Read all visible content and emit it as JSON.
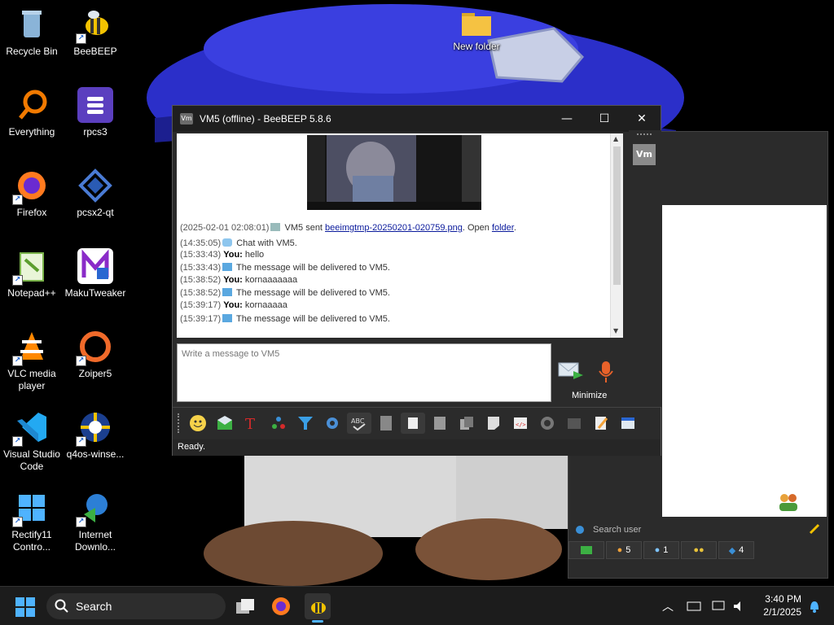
{
  "desktop": {
    "icons": [
      {
        "label": "Recycle Bin"
      },
      {
        "label": "BeeBEEP"
      },
      {
        "label": "Everything"
      },
      {
        "label": "rpcs3"
      },
      {
        "label": "Firefox"
      },
      {
        "label": "pcsx2-qt"
      },
      {
        "label": "Notepad++"
      },
      {
        "label": "MakuTweaker"
      },
      {
        "label": "VLC media player"
      },
      {
        "label": "Zoiper5"
      },
      {
        "label": "Visual Studio Code"
      },
      {
        "label": "q4os-winse..."
      },
      {
        "label": "Rectify11 Contro..."
      },
      {
        "label": "Internet Downlo..."
      },
      {
        "label": "New folder"
      }
    ]
  },
  "chat_window": {
    "title": "VM5 (offline) - BeeBEEP 5.8.6",
    "title_icon_text": "Vm",
    "avatar_text": "Vm",
    "log": [
      {
        "ts": "(2025-02-01 02:08:01)",
        "text": " VM5 sent ",
        "link": "beeimgtmp-20250201-020759.png",
        "after": ". Open ",
        "link2": "folder",
        "tail": "."
      },
      {
        "ts": "(14:35:05)",
        "text": " Chat with VM5."
      },
      {
        "ts": "(15:33:43)",
        "who": "You:",
        "text": " hello"
      },
      {
        "ts": "(15:33:43)",
        "text": " The message will be delivered to VM5."
      },
      {
        "ts": "(15:38:52)",
        "who": "You:",
        "text": " kornaaaaaaa"
      },
      {
        "ts": "(15:38:52)",
        "text": " The message will be delivered to VM5."
      },
      {
        "ts": "(15:39:17)",
        "who": "You:",
        "text": " kornaaaaa"
      },
      {
        "ts": "(15:39:17)",
        "text": " The message will be delivered to VM5."
      }
    ],
    "input_placeholder": "Write a message to VM5",
    "minimize_label": "Minimize",
    "status": "Ready."
  },
  "bg_window": {
    "search_placeholder": "Search user",
    "tabs": [
      {
        "count": ""
      },
      {
        "count": "5"
      },
      {
        "count": "1"
      },
      {
        "count": ""
      },
      {
        "count": "4"
      }
    ]
  },
  "taskbar": {
    "search_label": "Search",
    "time": "3:40 PM",
    "date": "2/1/2025"
  }
}
